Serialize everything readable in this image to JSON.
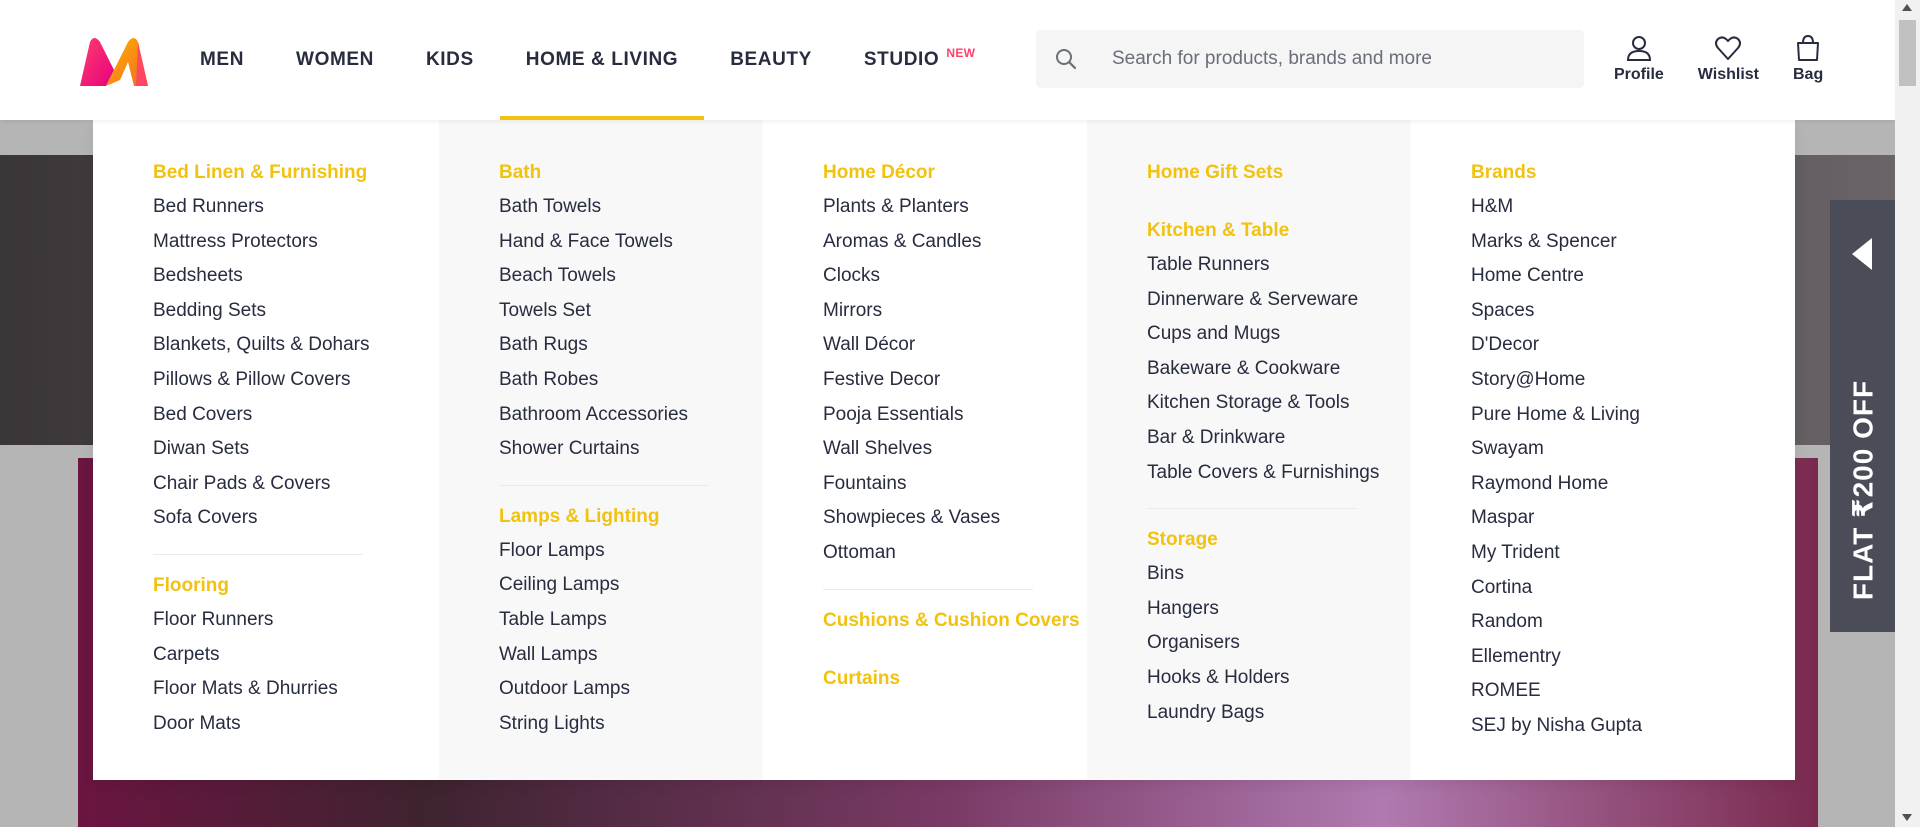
{
  "header": {
    "nav": [
      {
        "label": "MEN",
        "active": false
      },
      {
        "label": "WOMEN",
        "active": false
      },
      {
        "label": "KIDS",
        "active": false
      },
      {
        "label": "HOME & LIVING",
        "active": true
      },
      {
        "label": "BEAUTY",
        "active": false
      },
      {
        "label": "STUDIO",
        "active": false,
        "badge": "NEW"
      }
    ],
    "search": {
      "placeholder": "Search for products, brands and more",
      "value": ""
    },
    "actions": [
      {
        "label": "Profile",
        "icon": "profile-icon"
      },
      {
        "label": "Wishlist",
        "icon": "wishlist-icon"
      },
      {
        "label": "Bag",
        "icon": "bag-icon"
      }
    ]
  },
  "menu": {
    "columns": [
      {
        "groups": [
          {
            "title": "Bed Linen & Furnishing",
            "items": [
              "Bed Runners",
              "Mattress Protectors",
              "Bedsheets",
              "Bedding Sets",
              "Blankets, Quilts & Dohars",
              "Pillows & Pillow Covers",
              "Bed Covers",
              "Diwan Sets",
              "Chair Pads & Covers",
              "Sofa Covers"
            ]
          },
          {
            "title": "Flooring",
            "items": [
              "Floor Runners",
              "Carpets",
              "Floor Mats & Dhurries",
              "Door Mats"
            ]
          }
        ]
      },
      {
        "groups": [
          {
            "title": "Bath",
            "items": [
              "Bath Towels",
              "Hand & Face Towels",
              "Beach Towels",
              "Towels Set",
              "Bath Rugs",
              "Bath Robes",
              "Bathroom Accessories",
              "Shower Curtains"
            ]
          },
          {
            "title": "Lamps & Lighting",
            "items": [
              "Floor Lamps",
              "Ceiling Lamps",
              "Table Lamps",
              "Wall Lamps",
              "Outdoor Lamps",
              "String Lights"
            ]
          }
        ]
      },
      {
        "groups": [
          {
            "title": "Home Décor",
            "items": [
              "Plants & Planters",
              "Aromas & Candles",
              "Clocks",
              "Mirrors",
              "Wall Décor",
              "Festive Decor",
              "Pooja Essentials",
              "Wall Shelves",
              "Fountains",
              "Showpieces & Vases",
              "Ottoman"
            ]
          },
          {
            "title": "Cushions & Cushion Covers",
            "items": []
          },
          {
            "title": "Curtains",
            "items": []
          }
        ]
      },
      {
        "groups": [
          {
            "title": "Home Gift Sets",
            "items": []
          },
          {
            "title": "Kitchen & Table",
            "items": [
              "Table Runners",
              "Dinnerware & Serveware",
              "Cups and Mugs",
              "Bakeware & Cookware",
              "Kitchen Storage & Tools",
              "Bar & Drinkware",
              "Table Covers & Furnishings"
            ]
          },
          {
            "title": "Storage",
            "items": [
              "Bins",
              "Hangers",
              "Organisers",
              "Hooks & Holders",
              "Laundry Bags"
            ]
          }
        ]
      },
      {
        "groups": [
          {
            "title": "Brands",
            "items": [
              "H&M",
              "Marks & Spencer",
              "Home Centre",
              "Spaces",
              "D'Decor",
              "Story@Home",
              "Pure Home & Living",
              "Swayam",
              "Raymond Home",
              "Maspar",
              "My Trident",
              "Cortina",
              "Random",
              "Ellementry",
              "ROMEE",
              "SEJ by Nisha Gupta"
            ]
          }
        ]
      }
    ]
  },
  "side_tab": {
    "label": "FLAT ₹200 OFF"
  },
  "colors": {
    "accent": "#f2c210",
    "text": "#282c3f",
    "badge": "#ff3f6c"
  }
}
